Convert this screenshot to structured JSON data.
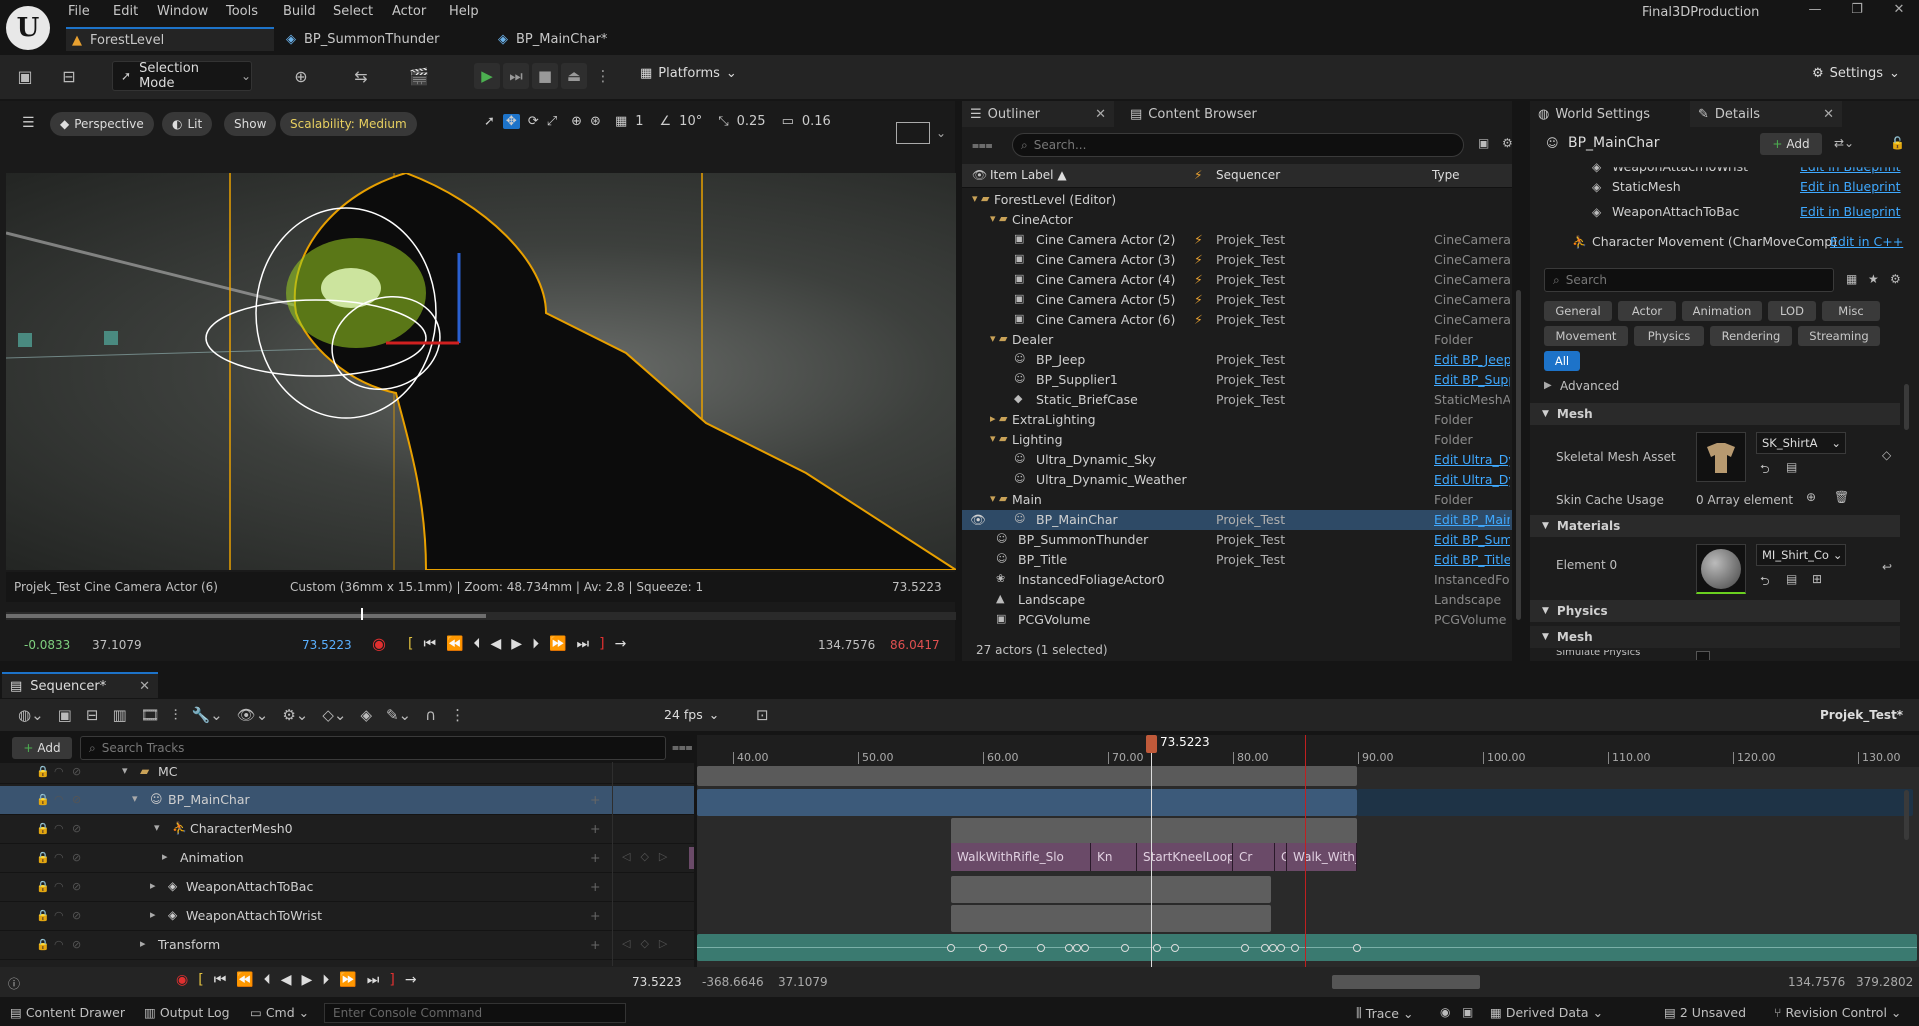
{
  "app": {
    "logo": "U",
    "title": "Final3DProduction",
    "window_controls": [
      "—",
      "❐",
      "✕"
    ]
  },
  "menu": [
    "File",
    "Edit",
    "Window",
    "Tools",
    "Build",
    "Select",
    "Actor",
    "Help"
  ],
  "doc_tabs": [
    {
      "label": "ForestLevel"
    },
    {
      "label": "BP_SummonThunder"
    },
    {
      "label": "BP_MainChar*"
    }
  ],
  "toolbar": {
    "selection_mode": "Selection Mode",
    "platforms": "Platforms",
    "settings": "Settings"
  },
  "viewport": {
    "perspective": "Perspective",
    "lit": "Lit",
    "show": "Show",
    "scalability": "Scalability: Medium",
    "grid": "1",
    "angle": "10°",
    "scale": "0.25",
    "camera_speed": "0.16",
    "camera_label": "Projek_Test Cine Camera Actor (6)",
    "lens_info": "Custom (36mm x 15.1mm) | Zoom: 48.734mm | Av: 2.8 | Squeeze: 1",
    "current_time": "73.5223",
    "range_start": "-0.0833",
    "range_in": "37.1079",
    "playhead": "73.5223",
    "range_out": "134.7576",
    "range_end": "86.0417"
  },
  "outliner": {
    "tab": "Outliner",
    "tab2": "Content Browser",
    "search_placeholder": "Search...",
    "col_label": "Item Label ▲",
    "col_seq": "Sequencer",
    "col_type": "Type",
    "status": "27 actors (1 selected)",
    "rows": [
      {
        "label": "ForestLevel (Editor)",
        "seq": "",
        "type": ""
      },
      {
        "label": "CineActor",
        "seq": "",
        "type": ""
      },
      {
        "label": "Cine Camera Actor (2)",
        "seq": "Projek_Test",
        "type": "CineCameraA"
      },
      {
        "label": "Cine Camera Actor (3)",
        "seq": "Projek_Test",
        "type": "CineCameraA"
      },
      {
        "label": "Cine Camera Actor (4)",
        "seq": "Projek_Test",
        "type": "CineCameraA"
      },
      {
        "label": "Cine Camera Actor (5)",
        "seq": "Projek_Test",
        "type": "CineCameraA"
      },
      {
        "label": "Cine Camera Actor (6)",
        "seq": "Projek_Test",
        "type": "CineCameraA"
      },
      {
        "label": "Dealer",
        "seq": "",
        "type": "Folder"
      },
      {
        "label": "BP_Jeep",
        "seq": "Projek_Test",
        "type": "Edit BP_Jeep"
      },
      {
        "label": "BP_Supplier1",
        "seq": "Projek_Test",
        "type": "Edit BP_Supp"
      },
      {
        "label": "Static_BriefCase",
        "seq": "Projek_Test",
        "type": "StaticMeshAc"
      },
      {
        "label": "ExtraLighting",
        "seq": "",
        "type": "Folder"
      },
      {
        "label": "Lighting",
        "seq": "",
        "type": "Folder"
      },
      {
        "label": "Ultra_Dynamic_Sky",
        "seq": "",
        "type": "Edit Ultra_Dy"
      },
      {
        "label": "Ultra_Dynamic_Weather",
        "seq": "",
        "type": "Edit Ultra_Dy"
      },
      {
        "label": "Main",
        "seq": "",
        "type": "Folder"
      },
      {
        "label": "BP_MainChar",
        "seq": "Projek_Test",
        "type": "Edit BP_Main"
      },
      {
        "label": "BP_SummonThunder",
        "seq": "Projek_Test",
        "type": "Edit BP_Summ"
      },
      {
        "label": "BP_Title",
        "seq": "Projek_Test",
        "type": "Edit BP_Title"
      },
      {
        "label": "InstancedFoliageActor0",
        "seq": "",
        "type": "InstancedFoli"
      },
      {
        "label": "Landscape",
        "seq": "",
        "type": "Landscape"
      },
      {
        "label": "PCGVolume",
        "seq": "",
        "type": "PCGVolume"
      }
    ]
  },
  "details": {
    "tab_world": "World Settings",
    "tab_details": "Details",
    "object_name": "BP_MainChar",
    "add_label": "Add",
    "components": [
      {
        "name": "WeaponAttachToWrist",
        "action": "Edit in Blueprint"
      },
      {
        "name": "StaticMesh",
        "action": "Edit in Blueprint"
      },
      {
        "name": "WeaponAttachToBac",
        "action": "Edit in Blueprint"
      },
      {
        "name": "Character Movement (CharMoveComp)",
        "action": "Edit in C++"
      }
    ],
    "search_placeholder": "Search",
    "filters": [
      "General",
      "Actor",
      "Animation",
      "LOD",
      "Misc",
      "Movement",
      "Physics",
      "Rendering",
      "Streaming",
      "All"
    ],
    "advanced": "Advanced",
    "sec_mesh": "Mesh",
    "skeletal_label": "Skeletal Mesh Asset",
    "skeletal_value": "SK_ShirtA",
    "skin_label": "Skin Cache Usage",
    "skin_value": "0 Array element",
    "sec_materials": "Materials",
    "element_label": "Element 0",
    "element_value": "MI_Shirt_Co",
    "sec_physics": "Physics",
    "sec_mesh2": "Mesh",
    "simulate_physics": "Simulate Physics"
  },
  "sequencer": {
    "tab": "Sequencer*",
    "fps": "24 fps",
    "sequence_name": "Projek_Test*",
    "add_label": "Add",
    "search_placeholder": "Search Tracks",
    "playhead": "73.5223",
    "ticks": [
      "40.00",
      "50.00",
      "60.00",
      "70.00",
      "80.00",
      "90.00",
      "100.00",
      "110.00",
      "120.00",
      "130.00"
    ],
    "tracks": [
      {
        "label": "MC"
      },
      {
        "label": "BP_MainChar"
      },
      {
        "label": "CharacterMesh0"
      },
      {
        "label": "Animation"
      },
      {
        "label": "WeaponAttachToBac"
      },
      {
        "label": "WeaponAttachToWrist"
      },
      {
        "label": "Transform"
      }
    ],
    "clips": [
      "WalkWithRifle_Slo",
      "Kn",
      "StartKneelLoop",
      "Cr",
      "C",
      "Walk_With_"
    ],
    "bottom": {
      "time": "73.5223",
      "view_start": "-368.6646",
      "view_in": "37.1079",
      "view_out": "134.7576",
      "view_end": "379.2802"
    }
  },
  "status": {
    "content_drawer": "Content Drawer",
    "output_log": "Output Log",
    "cmd": "Cmd",
    "console_placeholder": "Enter Console Command",
    "trace": "Trace",
    "derived": "Derived Data",
    "unsaved": "2 Unsaved",
    "revision": "Revision Control"
  },
  "colors": {
    "accent": "#1d73c9",
    "link": "#3fa9ff",
    "play": "#4caf50",
    "record": "#e03030",
    "folder": "#c9a257",
    "clip": "#6a4a68",
    "transform": "#3a7a70"
  }
}
